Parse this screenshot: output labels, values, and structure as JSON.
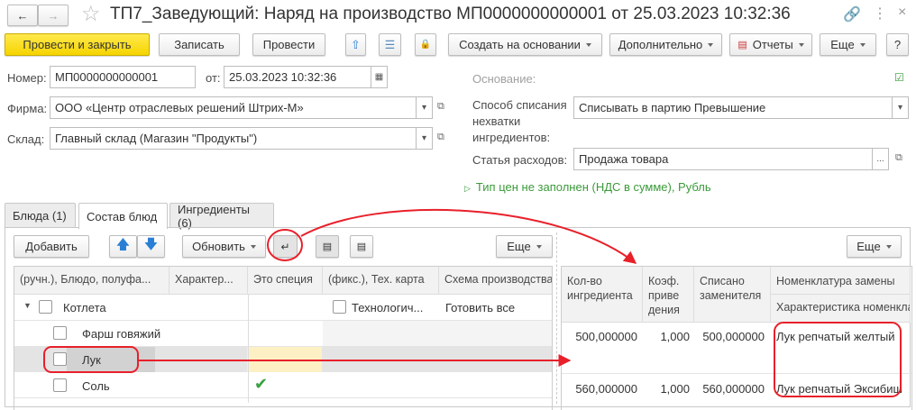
{
  "window": {
    "title": "ТП7_Заведующий: Наряд на производство МП0000000000001 от 25.03.2023 10:32:36"
  },
  "toolbar": {
    "post_close": "Провести и закрыть",
    "save": "Записать",
    "post": "Провести",
    "create_based": "Создать на основании",
    "additional": "Дополнительно",
    "reports": "Отчеты",
    "more": "Еще",
    "help": "?"
  },
  "form": {
    "number_label": "Номер:",
    "number": "МП0000000000001",
    "date_label": "от:",
    "date": "25.03.2023 10:32:36",
    "firm_label": "Фирма:",
    "firm": "ООО «Центр отраслевых решений Штрих-М»",
    "warehouse_label": "Склад:",
    "warehouse": "Главный склад (Магазин \"Продукты\")",
    "basis_label": "Основание:",
    "writeoff_label_1": "Способ списания",
    "writeoff_label_2": "нехватки",
    "writeoff_label_3": "ингредиентов:",
    "writeoff": "Списывать в партию Превышение",
    "expense_label": "Статья расходов:",
    "expense": "Продажа товара",
    "price_link": "Тип цен не заполнен (НДС в сумме), Рубль"
  },
  "tabs": [
    {
      "label": "Блюда (1)"
    },
    {
      "label": "Состав блюд",
      "active": true
    },
    {
      "label": "Ингредиенты (6)"
    }
  ],
  "left_toolbar": {
    "add": "Добавить",
    "refresh": "Обновить",
    "more": "Еще"
  },
  "left_table": {
    "headers": [
      "(ручн.), Блюдо, полуфа...",
      "Характер...",
      "Это специя",
      "(фикс.), Тех. карта",
      "Схема производства"
    ],
    "rows": [
      {
        "name": "Котлета",
        "card": "Технологич...",
        "scheme": "Готовить все",
        "spice": false
      },
      {
        "name": "Фарш говяжий",
        "spice": false
      },
      {
        "name": "Лук",
        "selected": true,
        "spice": false
      },
      {
        "name": "Соль",
        "spice": true
      }
    ]
  },
  "right_toolbar": {
    "more": "Еще"
  },
  "right_table": {
    "headers": {
      "qty": "Кол-во ингредиента",
      "coef": "Коэф. приве дения",
      "written": "Списано заменителя",
      "nom": "Номенклатура замены",
      "char": "Характеристика номенклатуры"
    },
    "rows": [
      {
        "qty": "500,000000",
        "coef": "1,000",
        "written": "500,000000",
        "nom": "Лук репчатый желтый"
      },
      {
        "qty": "560,000000",
        "coef": "1,000",
        "written": "560,000000",
        "nom": "Лук репчатый Эксибишн"
      }
    ]
  },
  "colors": {
    "accent": "#f6d400",
    "annotation": "#e8202a",
    "link": "#3a9a3a"
  }
}
